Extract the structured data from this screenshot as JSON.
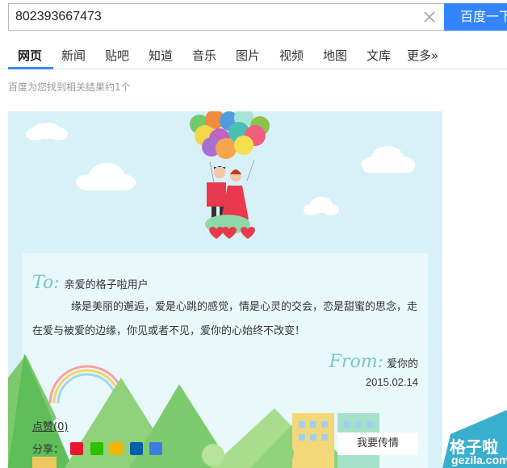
{
  "search": {
    "query": "802393667473",
    "button_label": "百度一下"
  },
  "tabs": [
    {
      "label": "网页",
      "active": true
    },
    {
      "label": "新闻"
    },
    {
      "label": "贴吧"
    },
    {
      "label": "知道"
    },
    {
      "label": "音乐"
    },
    {
      "label": "图片"
    },
    {
      "label": "视频"
    },
    {
      "label": "地图"
    },
    {
      "label": "文库"
    },
    {
      "label": "更多»"
    }
  ],
  "result_count": "百度为您找到相关结果约1个",
  "card": {
    "to_script": "To:",
    "salutation": "亲爱的格子啦用户",
    "message": "缘是美丽的邂逅，爱是心跳的感觉，情是心灵的交会，恋是甜蜜的思念，走在爱与被爱的边缘，你见或者不见，爱你的心始终不改变！",
    "from_script": "From:",
    "signature": "爱你的",
    "date": "2015.02.14",
    "like_label": "点赞(0)",
    "share_label": "分享：",
    "share_icons": [
      "weibo-icon",
      "wechat-icon",
      "qzone-icon",
      "renren-icon",
      "tieba-icon"
    ],
    "pass_button": "我要传情"
  },
  "watermark": {
    "title": "格子啦",
    "url": "gezila.com"
  },
  "colors": {
    "accent": "#3385ff",
    "card_bg": "#d8f1f8",
    "script_teal": "#7cc7c0"
  }
}
